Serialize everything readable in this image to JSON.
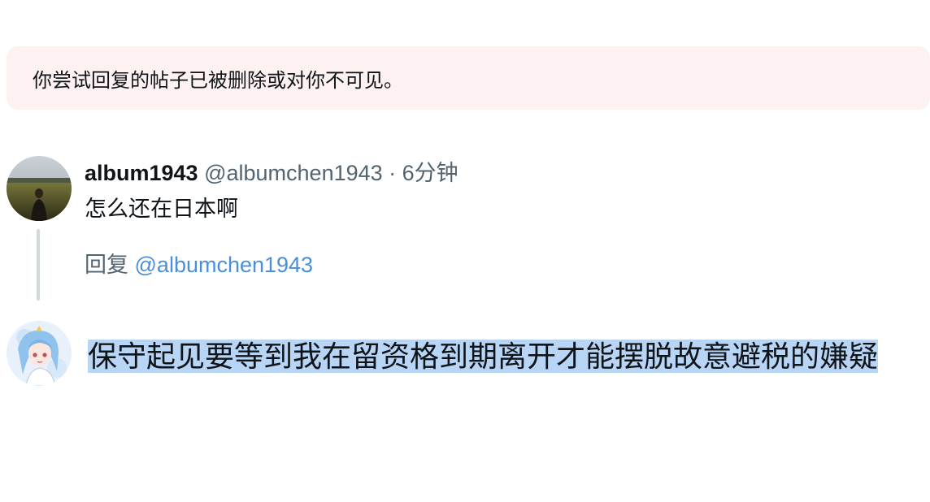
{
  "notice": {
    "text": "你尝试回复的帖子已被删除或对你不可见。"
  },
  "original_post": {
    "display_name": "album1943",
    "handle": "@albumchen1943",
    "separator": " · ",
    "time": "6分钟",
    "text": "怎么还在日本啊"
  },
  "reply": {
    "prefix": "回复 ",
    "mention": "@albumchen1943"
  },
  "composer": {
    "draft_text": "保守起见要等到我在留资格到期离开才能摆脱故意避税的嫌疑",
    "selection_color": "#b9d5f6"
  },
  "colors": {
    "notice_bg": "#fdf1f1",
    "mention": "#4a8fd8",
    "meta": "#536471",
    "thread_line": "#cfd9de"
  }
}
